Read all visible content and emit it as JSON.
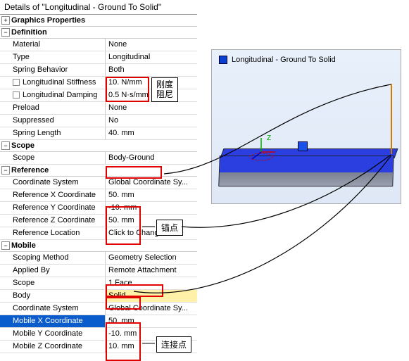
{
  "title": "Details of \"Longitudinal - Ground To Solid\"",
  "sections": {
    "graphics": "Graphics Properties",
    "definition": "Definition",
    "scope": "Scope",
    "reference": "Reference",
    "mobile": "Mobile"
  },
  "def": {
    "material_k": "Material",
    "material_v": "None",
    "type_k": "Type",
    "type_v": "Longitudinal",
    "behavior_k": "Spring Behavior",
    "behavior_v": "Both",
    "stiff_k": "Longitudinal Stiffness",
    "stiff_v": "10. N/mm",
    "damp_k": "Longitudinal Damping",
    "damp_v": "0.5 N·s/mm",
    "preload_k": "Preload",
    "preload_v": "None",
    "supp_k": "Suppressed",
    "supp_v": "No",
    "len_k": "Spring Length",
    "len_v": "40. mm"
  },
  "scope_row": {
    "k": "Scope",
    "v": "Body-Ground"
  },
  "ref": {
    "cs_k": "Coordinate System",
    "cs_v": "Global Coordinate Sy...",
    "x_k": "Reference X Coordinate",
    "x_v": "50. mm",
    "y_k": "Reference Y Coordinate",
    "y_v": "-10. mm",
    "z_k": "Reference Z Coordinate",
    "z_v": "50. mm",
    "loc_k": "Reference Location",
    "loc_v": "Click to Change"
  },
  "mob": {
    "meth_k": "Scoping Method",
    "meth_v": "Geometry Selection",
    "app_k": "Applied By",
    "app_v": "Remote Attachment",
    "scope_k": "Scope",
    "scope_v": "1 Face",
    "body_k": "Body",
    "body_v": "Solid",
    "cs_k": "Coordinate System",
    "cs_v": "Global Coordinate Sy...",
    "x_k": "Mobile X Coordinate",
    "x_v": "50. mm",
    "y_k": "Mobile Y Coordinate",
    "y_v": "-10. mm",
    "z_k": "Mobile Z Coordinate",
    "z_v": "10. mm"
  },
  "anno": {
    "stiff": "刚度\n阻尼",
    "anchor": "锚点",
    "connect": "连接点"
  },
  "legend": "Longitudinal - Ground To Solid",
  "axis_z": "Z"
}
